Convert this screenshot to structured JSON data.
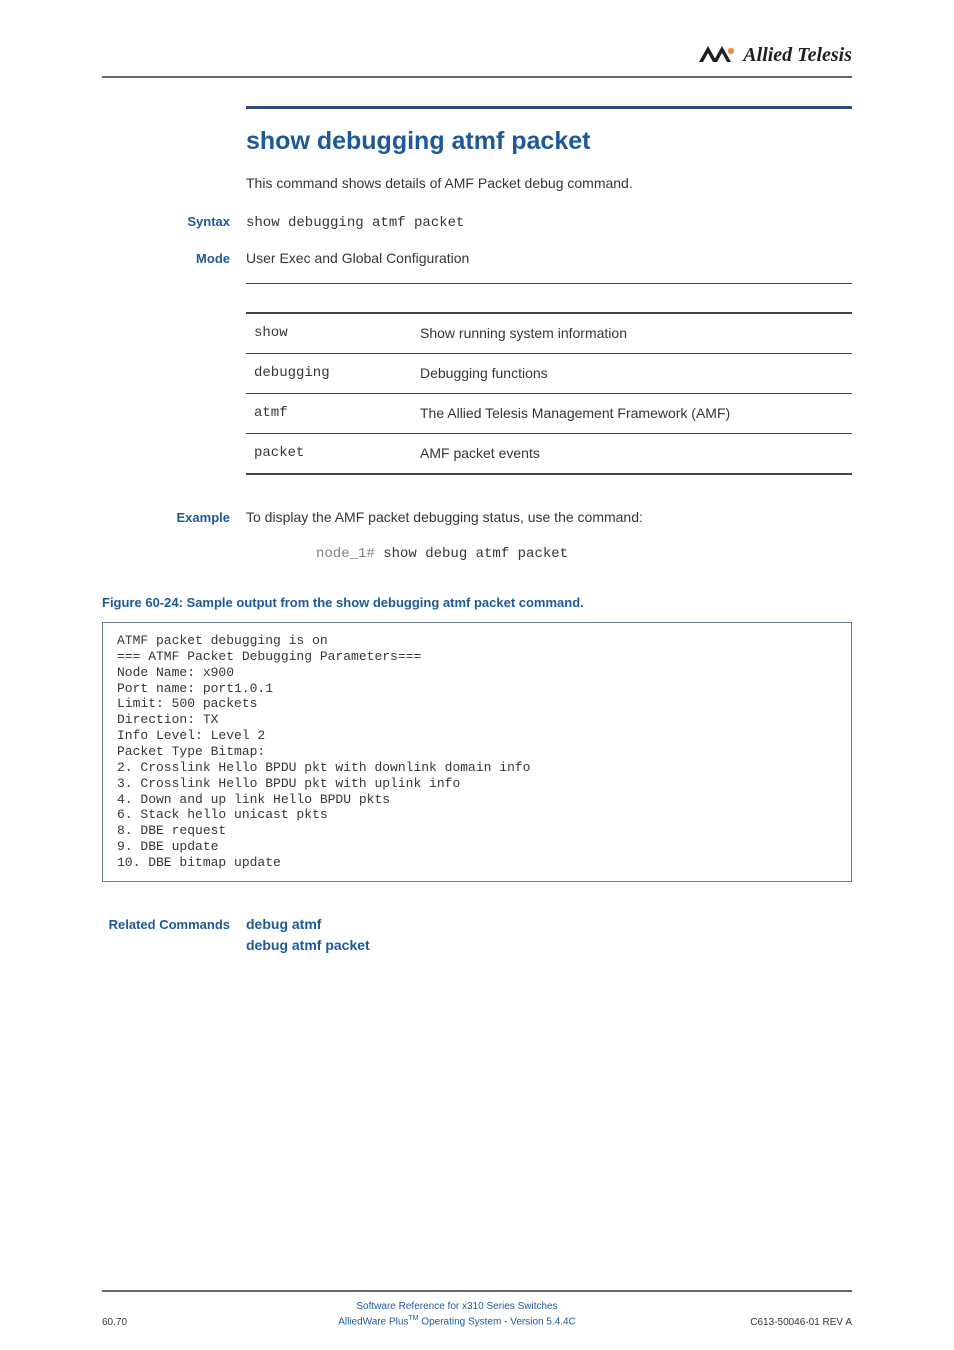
{
  "header": {
    "brand": "Allied Telesis"
  },
  "title": "show debugging atmf packet",
  "intro": "This command shows details of AMF Packet debug command.",
  "sections": {
    "syntax": {
      "label": "Syntax",
      "value": "show debugging atmf packet"
    },
    "mode": {
      "label": "Mode",
      "value": "User Exec and Global Configuration"
    },
    "example": {
      "label": "Example",
      "value": "To display the AMF packet debugging status, use the command:",
      "prompt": "node_1#",
      "cmd": " show debug atmf packet"
    },
    "related": {
      "label": "Related Commands",
      "links": [
        "debug atmf",
        "debug atmf packet"
      ]
    }
  },
  "param_table": [
    {
      "param": "show",
      "desc": "Show running system information"
    },
    {
      "param": "debugging",
      "desc": "Debugging functions"
    },
    {
      "param": "atmf",
      "desc": "The Allied Telesis Management Framework (AMF)"
    },
    {
      "param": "packet",
      "desc": "AMF packet events"
    }
  ],
  "figure": {
    "caption": "Figure 60-24: Sample output from the show debugging atmf  packet command.",
    "output": "ATMF packet debugging is on\n=== ATMF Packet Debugging Parameters===\nNode Name: x900\nPort name: port1.0.1\nLimit: 500 packets\nDirection: TX\nInfo Level: Level 2\nPacket Type Bitmap:\n2. Crosslink Hello BPDU pkt with downlink domain info\n3. Crosslink Hello BPDU pkt with uplink info\n4. Down and up link Hello BPDU pkts\n6. Stack hello unicast pkts\n8. DBE request\n9. DBE update\n10. DBE bitmap update"
  },
  "footer": {
    "page_num": "60.70",
    "line1": "Software Reference for x310 Series Switches",
    "line2_a": "AlliedWare Plus",
    "line2_b": " Operating System  - Version 5.4.4C",
    "rev": "C613-50046-01 REV A",
    "tm": "TM"
  }
}
